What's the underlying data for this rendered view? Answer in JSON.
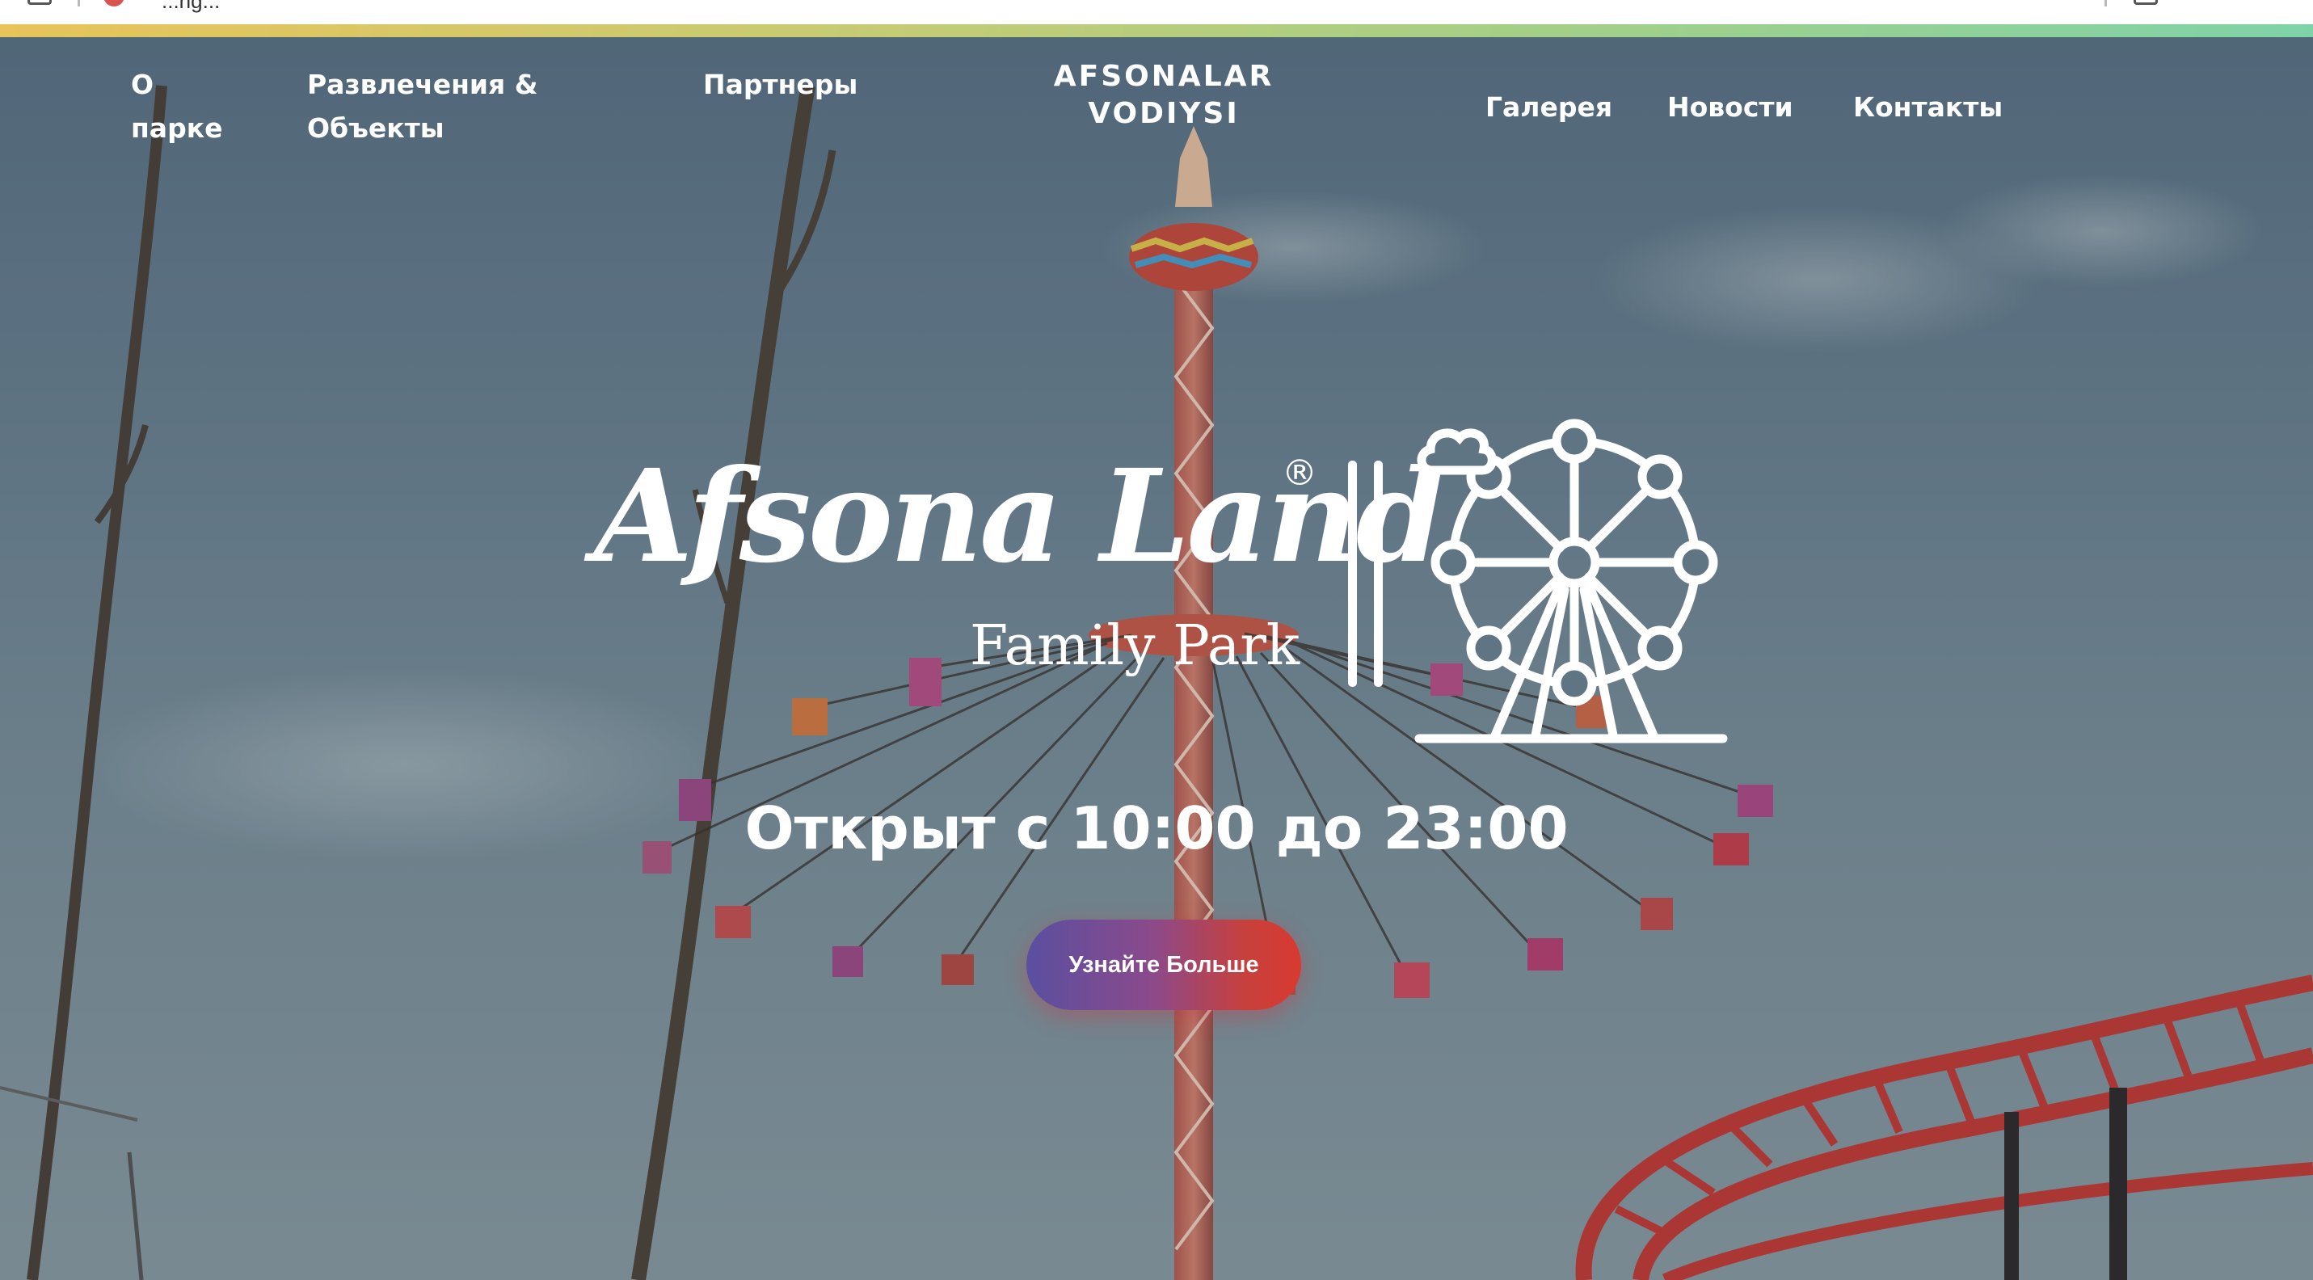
{
  "browser": {
    "url_fragment": "...ng..."
  },
  "nav": {
    "about_line1": "О",
    "about_line2": "парке",
    "attractions_line1": "Развлечения &",
    "attractions_line2": "Объекты",
    "partners": "Партнеры",
    "logo_line1": "AFSONALAR",
    "logo_line2": "VODIYSI",
    "gallery": "Галерея",
    "news": "Новости",
    "contacts": "Контакты"
  },
  "hero": {
    "brand_name": "Afsona Land",
    "brand_mark": "®",
    "brand_subtitle": "Family Park",
    "hours": "Открыт с 10:00 до 23:00",
    "cta_label": "Узнайте Больше"
  },
  "colors": {
    "gradient_bar_start": "#e8c45a",
    "gradient_bar_end": "#7fd2a8",
    "cta_start": "#5a4fa0",
    "cta_end": "#d83a30",
    "text": "#ffffff"
  },
  "icons": {
    "tab": "tab-icon",
    "favicon": "site-favicon",
    "extension": "extension-icon",
    "ferris": "ferris-wheel-icon"
  }
}
